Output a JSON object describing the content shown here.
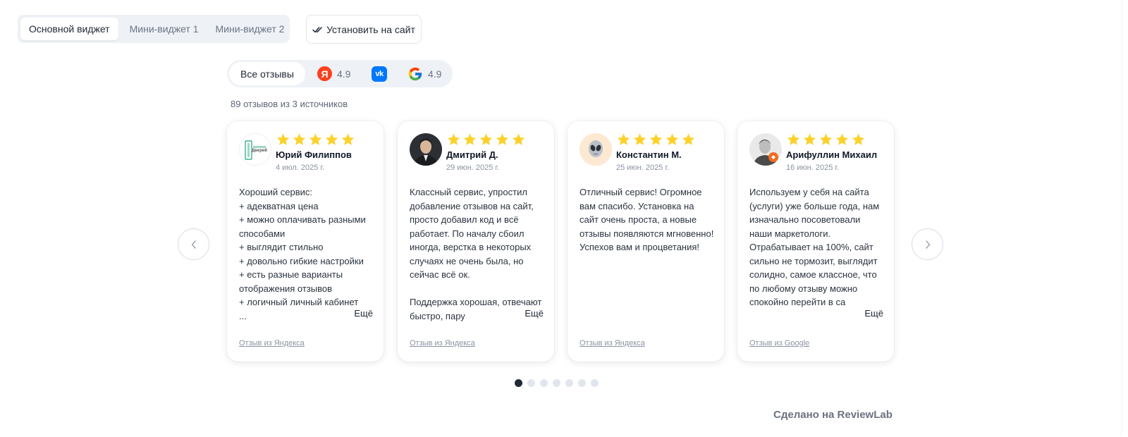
{
  "tabs": [
    "Основной виджет",
    "Мини-виджет 1",
    "Мини-виджет 2"
  ],
  "install_label": "Установить на сайт",
  "sources": {
    "all_label": "Все отзывы",
    "yandex": {
      "icon": "yandex-icon",
      "rating": "4.9",
      "color": "#fc3f1d"
    },
    "vk": {
      "icon": "vk-icon",
      "color": "#0077ff"
    },
    "google": {
      "icon": "google-icon",
      "rating": "4.9"
    }
  },
  "count_text": "89 отзывов из 3 источников",
  "reviews": [
    {
      "name": "Юрий Филиппов",
      "date": "4 июл. 2025 г.",
      "stars": 5,
      "text": "Хороший сервис:\n+ адекватная цена\n+ можно оплачивать разными способами\n+ выглядит стильно\n+ довольно гибкие настройки\n+ есть разные варианты отображения отзывов\n+ логичный личный кабинет\n...",
      "more": "Ещё",
      "source": "Отзыв из Яндекса",
      "avatar_text": "Дверей"
    },
    {
      "name": "Дмитрий Д.",
      "date": "29 июн. 2025 г.",
      "stars": 5,
      "text": "Классный сервис, упростил добавление отзывов на сайт, просто добавил код и всё работает. По началу сбоил иногда, верстка в некоторых случаях не очень была, но сейчас всё ок.\n\nПоддержка хорошая, отвечают быстро, пару",
      "more": "Ещё",
      "source": "Отзыв из Яндекса"
    },
    {
      "name": "Константин М.",
      "date": "25 июн. 2025 г.",
      "stars": 5,
      "text": "Отличный сервис! Огромное вам спасибо. Установка на сайт очень проста, а новые отзывы появляются мгновенно! Успехов вам и процветания!",
      "source": "Отзыв из Яндекса"
    },
    {
      "name": "Арифуллин Михаил",
      "date": "16 июн. 2025 г.",
      "stars": 5,
      "text": "Используем у себя на сайта (услуги) уже больше года, нам изначально посоветовали наши маркетологи. Отрабатывает на 100%, сайт сильно не тормозит, выглядит солидно, самое классное, что по любому отзыву можно спокойно перейти в са",
      "more": "Ещё",
      "source": "Отзыв из Google"
    }
  ],
  "pagination": {
    "total": 7,
    "active": 0
  },
  "made_with": "Сделано на ReviewLab",
  "colors": {
    "star": "#fcd12a",
    "accent_dark": "#1f2937"
  }
}
